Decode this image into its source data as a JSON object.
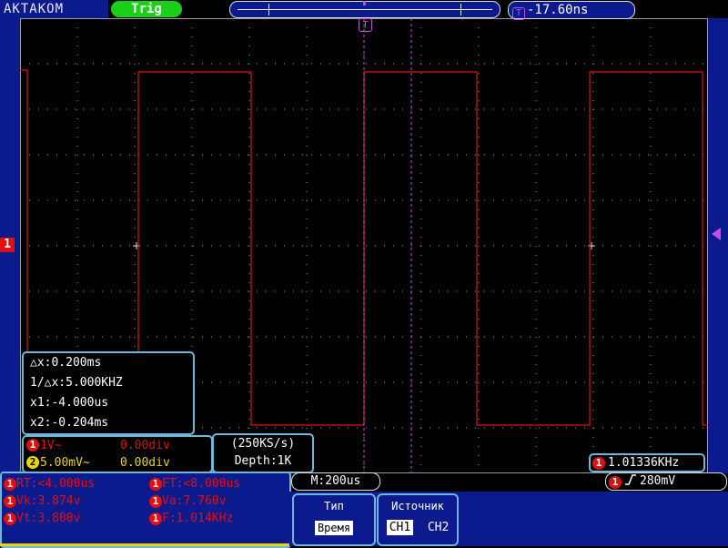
{
  "header": {
    "brand": "AKTAKOM",
    "trig_status": "Trig",
    "trigger_position": "-17.60ns",
    "trigger_icon": "T"
  },
  "screen": {
    "ch1_marker": "1",
    "trig_marker": "T"
  },
  "cursor_panel": {
    "dx": "△x:0.200ms",
    "inv_dx": "1/△x:5.000KHZ",
    "x1": "x1:-4.000us",
    "x2": "x2:-0.204ms"
  },
  "channels": [
    {
      "num": "1",
      "scale": "1V~",
      "offset": "0.00div",
      "color": "#e01010"
    },
    {
      "num": "2",
      "scale": "5.00mV~",
      "offset": "0.00div",
      "color": "#e8d800"
    }
  ],
  "acquisition": {
    "rate": "(250KS/s)",
    "depth": "Depth:1K"
  },
  "frequency_counter": {
    "channel": "1",
    "value": "1.01336KHz"
  },
  "measurements": [
    {
      "ch": "1",
      "text": "RT:<4.000us"
    },
    {
      "ch": "1",
      "text": "FT:<8.000us"
    },
    {
      "ch": "1",
      "text": "Vk:3.874v"
    },
    {
      "ch": "1",
      "text": "Va:7.760v"
    },
    {
      "ch": "1",
      "text": "Vt:3.800v"
    },
    {
      "ch": "1",
      "text": "F:1.014KHz"
    }
  ],
  "timebase": "M:200us",
  "trigger_level": {
    "channel": "1",
    "slope_icon": "rising-edge",
    "value": "280mV"
  },
  "menu": {
    "type_title": "Тип",
    "type_value": "Время",
    "source_title": "Источник",
    "source_ch1": "CH1",
    "source_ch2": "CH2"
  },
  "colors": {
    "ch1": "#e01010",
    "ch2": "#e8d800",
    "frame": "#0b1a8c",
    "cursor": "#c050e0",
    "trig_ok": "#18d018"
  }
}
